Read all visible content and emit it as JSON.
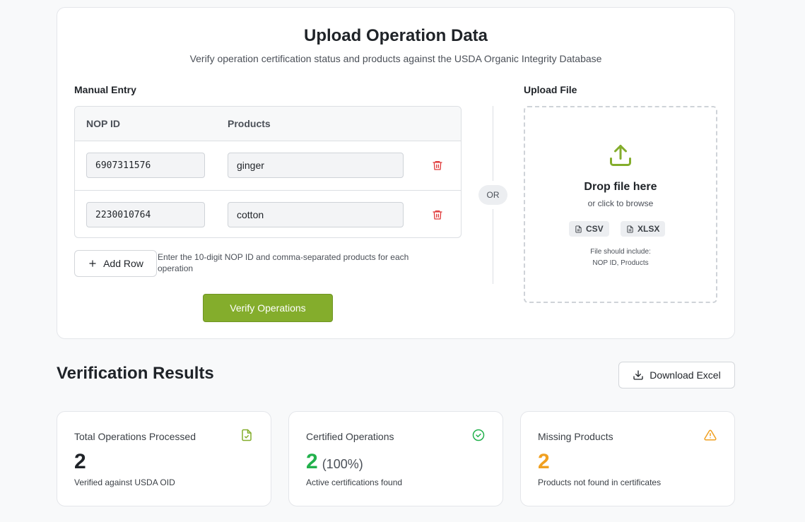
{
  "upload": {
    "title": "Upload Operation Data",
    "subtitle": "Verify operation certification status and products against the USDA Organic Integrity Database"
  },
  "manual_entry": {
    "label": "Manual Entry",
    "columns": [
      "NOP ID",
      "Products"
    ],
    "rows": [
      {
        "nop_id": "6907311576",
        "products": "ginger"
      },
      {
        "nop_id": "2230010764",
        "products": "cotton"
      }
    ],
    "add_row_label": "Add Row",
    "hint": "Enter the 10-digit NOP ID and comma-separated products for each operation",
    "verify_label": "Verify Operations"
  },
  "divider": {
    "or_label": "OR"
  },
  "file_upload": {
    "label": "Upload File",
    "drop_main": "Drop file here",
    "drop_sub": "or click to browse",
    "formats": [
      "CSV",
      "XLSX"
    ],
    "note_line1": "File should include:",
    "note_line2": "NOP ID, Products"
  },
  "results": {
    "title": "Verification Results",
    "download_label": "Download Excel",
    "cards": [
      {
        "label": "Total Operations Processed",
        "value": "2",
        "desc": "Verified against USDA OID",
        "icon": "file-check-icon",
        "color": "#1f2328"
      },
      {
        "label": "Certified Operations",
        "value": "2",
        "extra": "(100%)",
        "desc": "Active certifications found",
        "icon": "check-circle-icon",
        "color": "#22b14c"
      },
      {
        "label": "Missing Products",
        "value": "2",
        "desc": "Products not found in certificates",
        "icon": "alert-triangle-icon",
        "color": "#f0a020"
      }
    ]
  },
  "colors": {
    "accent": "#84ad2c",
    "danger": "#e03b3b",
    "success": "#22b14c",
    "warning": "#f0a020"
  }
}
